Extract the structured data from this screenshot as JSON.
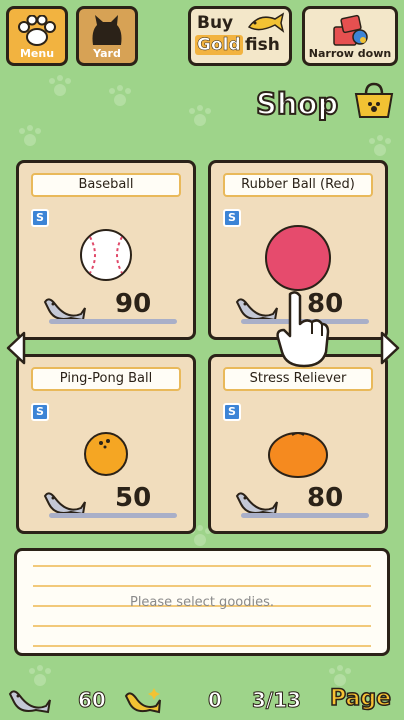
{
  "topbar": {
    "menu_label": "Menu",
    "yard_label": "Yard",
    "buy_line1": "Buy",
    "buy_gold": "Gold",
    "buy_fish": "fish",
    "narrow_label": "Narrow down"
  },
  "shop": {
    "title": "Shop"
  },
  "items": [
    {
      "name": "Baseball",
      "price": "90",
      "currency": "S"
    },
    {
      "name": "Rubber Ball (Red)",
      "price": "80",
      "currency": "S"
    },
    {
      "name": "Ping-Pong Ball",
      "price": "50",
      "currency": "S"
    },
    {
      "name": "Stress Reliever",
      "price": "80",
      "currency": "S"
    }
  ],
  "description": {
    "placeholder": "Please select goodies."
  },
  "footer": {
    "silver_fish": "60",
    "gold_fish": "0",
    "page": "3/13",
    "page_label": "Page"
  },
  "colors": {
    "background": "#9ed48a",
    "card": "#f1ddbd",
    "accent_gold": "#f2b340"
  }
}
